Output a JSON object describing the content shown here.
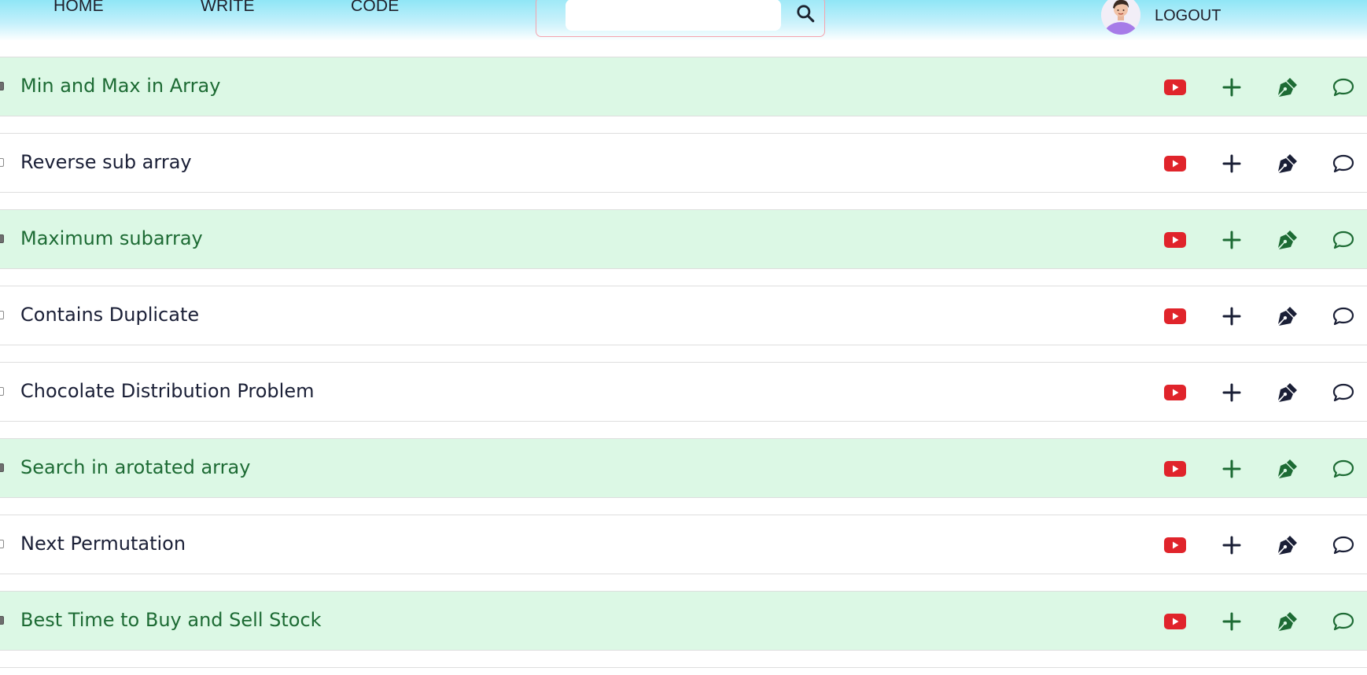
{
  "nav": {
    "home": "HOME",
    "write": "WRITE",
    "code": "CODE",
    "logout": "LOGOUT"
  },
  "search": {
    "placeholder": ""
  },
  "colors": {
    "done_bg": "#dcf8e5",
    "done_text": "#1d6b34",
    "todo_text": "#1a1f36",
    "youtube_red": "#e0242b",
    "header_top": "#8fe6f6"
  },
  "icons": {
    "video": "youtube-icon",
    "add": "plus-icon",
    "write": "pen-nib-icon",
    "comment": "comment-icon",
    "search": "search-icon"
  },
  "problems": [
    {
      "title": "Min and Max in Array",
      "completed": true
    },
    {
      "title": "Reverse sub array",
      "completed": false
    },
    {
      "title": "Maximum subarray",
      "completed": true
    },
    {
      "title": "Contains Duplicate",
      "completed": false
    },
    {
      "title": "Chocolate Distribution Problem",
      "completed": false
    },
    {
      "title": "Search in arotated array",
      "completed": true
    },
    {
      "title": "Next Permutation",
      "completed": false
    },
    {
      "title": "Best Time to Buy and Sell Stock",
      "completed": true
    }
  ]
}
